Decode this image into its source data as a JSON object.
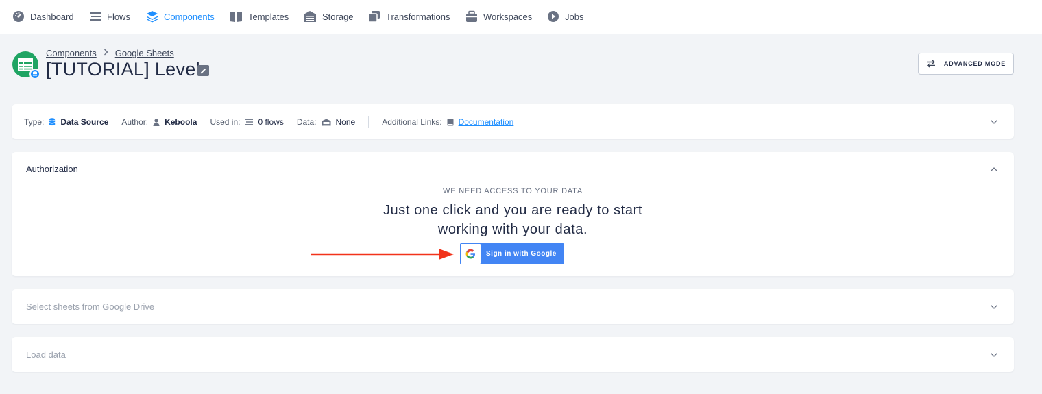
{
  "nav": {
    "items": [
      {
        "label": "Dashboard",
        "icon": "dashboard-icon",
        "active": false
      },
      {
        "label": "Flows",
        "icon": "flows-icon",
        "active": false
      },
      {
        "label": "Components",
        "icon": "components-icon",
        "active": true
      },
      {
        "label": "Templates",
        "icon": "templates-icon",
        "active": false
      },
      {
        "label": "Storage",
        "icon": "storage-icon",
        "active": false
      },
      {
        "label": "Transformations",
        "icon": "transformations-icon",
        "active": false
      },
      {
        "label": "Workspaces",
        "icon": "workspaces-icon",
        "active": false
      },
      {
        "label": "Jobs",
        "icon": "jobs-icon",
        "active": false
      }
    ]
  },
  "header": {
    "breadcrumb": [
      "Components",
      "Google Sheets"
    ],
    "title": "[TUTORIAL] Level",
    "advanced_mode_label": "ADVANCED MODE"
  },
  "info": {
    "type_label": "Type:",
    "type_value": "Data Source",
    "author_label": "Author:",
    "author_value": "Keboola",
    "used_in_label": "Used in:",
    "used_in_value": "0 flows",
    "data_label": "Data:",
    "data_value": "None",
    "links_label": "Additional Links:",
    "links_value": "Documentation"
  },
  "authorization": {
    "title": "Authorization",
    "kicker": "WE NEED ACCESS TO YOUR DATA",
    "heading_line1": "Just one click and you are ready to start",
    "heading_line2": "working with your data.",
    "google_button_label": "Sign in with Google"
  },
  "sections": {
    "select_sheets_title": "Select sheets from Google Drive",
    "load_data_title": "Load data"
  },
  "colors": {
    "accent": "#1f8fff",
    "google_blue": "#4285f4",
    "sheets_green": "#1fa463",
    "arrow_red": "#f2331b"
  }
}
